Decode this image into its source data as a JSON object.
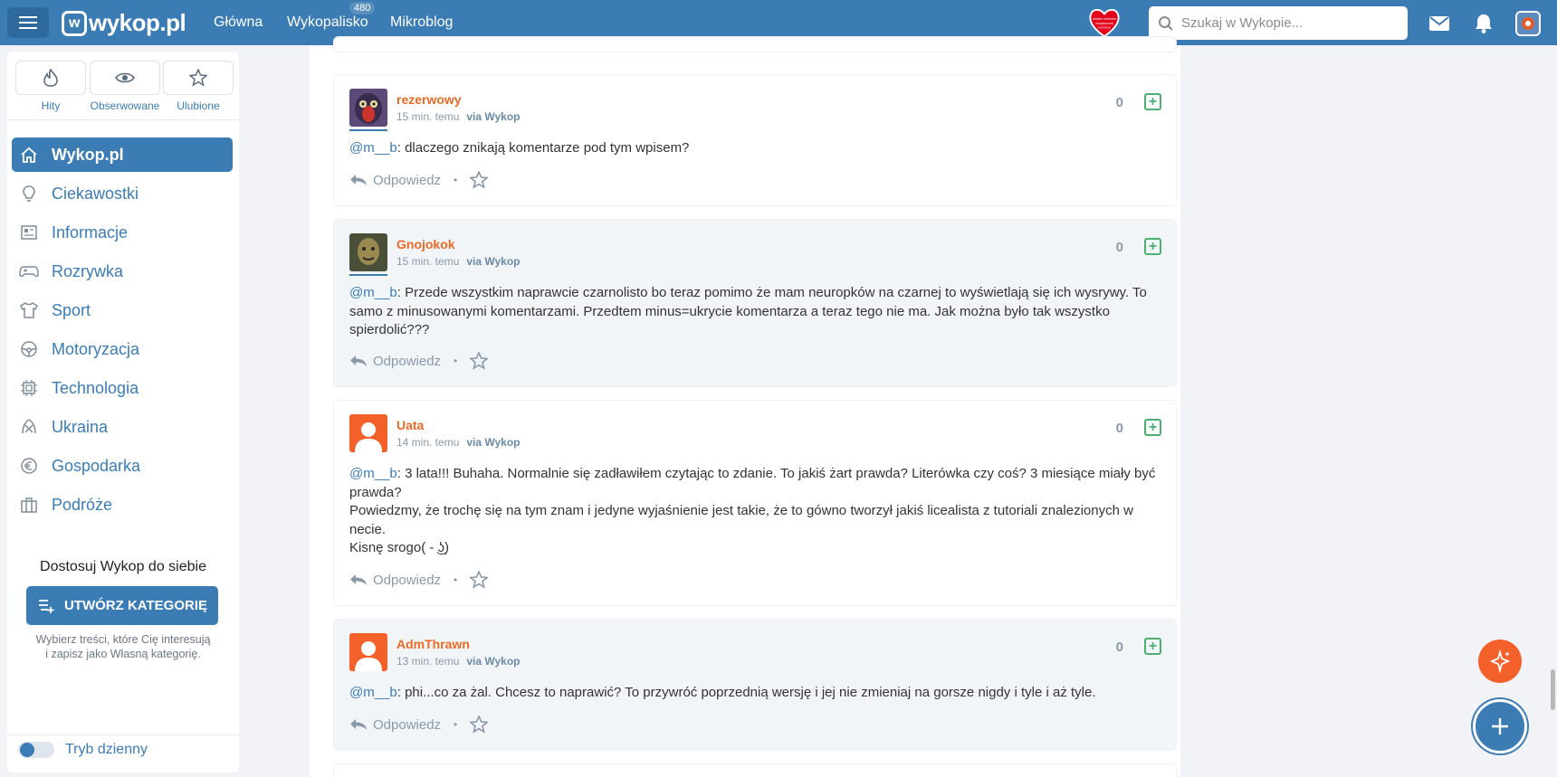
{
  "header": {
    "logo": "wykop.pl",
    "nav": [
      {
        "label": "Główna"
      },
      {
        "label": "Wykopalisko",
        "badge": "480"
      },
      {
        "label": "Mikroblog"
      }
    ],
    "search_placeholder": "Szukaj w Wykopie...",
    "icons": [
      "menu-icon",
      "wosp-heart-icon",
      "search-icon",
      "mail-icon",
      "bell-icon",
      "user-avatar"
    ]
  },
  "sidebar": {
    "quick": [
      {
        "label": "Hity",
        "icon": "flame-icon"
      },
      {
        "label": "Obserwowane",
        "icon": "eye-icon"
      },
      {
        "label": "Ulubione",
        "icon": "star-icon"
      }
    ],
    "items": [
      {
        "label": "Wykop.pl",
        "icon": "home-icon",
        "active": true
      },
      {
        "label": "Ciekawostki",
        "icon": "bulb-icon"
      },
      {
        "label": "Informacje",
        "icon": "newspaper-icon"
      },
      {
        "label": "Rozrywka",
        "icon": "gamepad-icon"
      },
      {
        "label": "Sport",
        "icon": "shirt-icon"
      },
      {
        "label": "Motoryzacja",
        "icon": "steering-wheel-icon"
      },
      {
        "label": "Technologia",
        "icon": "chip-icon"
      },
      {
        "label": "Ukraina",
        "icon": "ukraine-icon"
      },
      {
        "label": "Gospodarka",
        "icon": "euro-icon"
      },
      {
        "label": "Podróże",
        "icon": "suitcase-icon"
      }
    ],
    "customize_title": "Dostosuj Wykop do siebie",
    "create_label": "UTWÓRZ KATEGORIĘ",
    "hint_line1": "Wybierz treści, które Cię interesują",
    "hint_line2": "i zapisz jako Własną kategorię.",
    "theme_label": "Tryb dzienny"
  },
  "comments": [
    {
      "author": "rezerwowy",
      "time": "15 min. temu",
      "via": "via Wykop",
      "votes": "0",
      "mention": "@m__b",
      "lines": [
        ": dlaczego znikają komentarze pod tym wpisem?"
      ]
    },
    {
      "author": "Gnojokok",
      "time": "15 min. temu",
      "via": "via Wykop",
      "votes": "0",
      "mention": "@m__b",
      "lines": [
        ": Przede wszystkim naprawcie czarnolisto bo teraz pomimo że mam neuropków na czarnej to wyświetlają się ich wysrywy. To",
        "samo z minusowanymi komentarzami. Przedtem minus=ukrycie komentarza a teraz tego nie ma. Jak można było tak wszystko",
        "spierdolić???"
      ]
    },
    {
      "author": "Uata",
      "time": "14 min. temu",
      "via": "via Wykop",
      "votes": "0",
      "mention": "@m__b",
      "lines": [
        ": 3 lata!!! Buhaha. Normalnie się zadławiłem czytając to zdanie. To jakiś żart prawda? Literówka czy coś? 3 miesiące miały być",
        "prawda?",
        "Powiedzmy, że trochę się na tym znam i jedyne wyjaśnienie jest takie, że to gówno tworzył jakiś licealista z tutoriali znalezionych w",
        "necie.",
        "Kisnę srogo( - ͜ʖ)"
      ]
    },
    {
      "author": "AdmThrawn",
      "time": "13 min. temu",
      "via": "via Wykop",
      "votes": "0",
      "mention": "@m__b",
      "lines": [
        ": phi...co za żal. Chcesz to naprawić? To przywróć poprzednią wersję i jej nie zmieniaj na gorsze nigdy i tyle i aż tyle."
      ]
    }
  ],
  "actions": {
    "reply": "Odpowiedz",
    "dot": "•"
  },
  "colors": {
    "brand": "#3b7cb5",
    "author": "#ea6a25",
    "plus": "#4caf72",
    "fab": "#f4602a"
  }
}
